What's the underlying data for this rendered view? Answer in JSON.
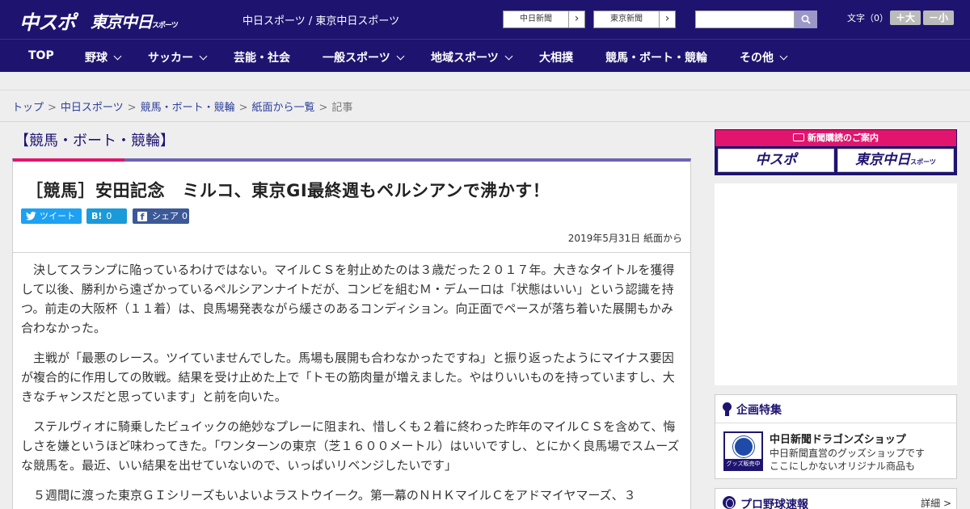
{
  "header": {
    "logo_chuspo": "中スポ",
    "logo_tokyo": "東京中日",
    "logo_tokyo_suffix": "スポーツ",
    "site_links": "中日スポーツ / 東京中日スポーツ",
    "paper_buttons": [
      "中日新聞",
      "東京新聞"
    ],
    "arrow": "›",
    "search": {
      "placeholder": "",
      "icon": "search-icon"
    },
    "font_size": {
      "label": "文字（0）",
      "larger": "＋大",
      "smaller": "－小"
    }
  },
  "nav": {
    "items": [
      {
        "label": "TOP",
        "has_dropdown": false
      },
      {
        "label": "野球",
        "has_dropdown": true
      },
      {
        "label": "サッカー",
        "has_dropdown": true
      },
      {
        "label": "芸能・社会",
        "has_dropdown": false
      },
      {
        "label": "一般スポーツ",
        "has_dropdown": true
      },
      {
        "label": "地域スポーツ",
        "has_dropdown": true
      },
      {
        "label": "大相撲",
        "has_dropdown": false
      },
      {
        "label": "競馬・ボート・競輪",
        "has_dropdown": false
      },
      {
        "label": "その他",
        "has_dropdown": true
      }
    ]
  },
  "breadcrumb": {
    "items": [
      "トップ",
      "中日スポーツ",
      "競馬・ボート・競輪",
      "紙面から一覧",
      "記事"
    ],
    "separator": ">"
  },
  "category_title": "【競馬・ボート・競輪】",
  "article": {
    "headline": "［競馬］安田記念　ミルコ、東京GI最終週もペルシアンで沸かす！",
    "share": {
      "tweet": "ツイート",
      "hatena_icon": "B!",
      "hatena_count": "0",
      "facebook_icon": "f",
      "facebook_label": "シェア",
      "facebook_count": "0"
    },
    "date": "2019年5月31日 紙面から",
    "paragraphs": [
      "決してスランプに陥っているわけではない。マイルＣＳを射止めたのは３歳だった２０１７年。大きなタイトルを獲得して以後、勝利から遠ざかっているペルシアンナイトだが、コンビを組むＭ・デムーロは「状態はいい」という認識を持つ。前走の大阪杯（１１着）は、良馬場発表ながら緩さのあるコンディション。向正面でペースが落ち着いた展開もかみ合わなかった。",
      "主戦が「最悪のレース。ツイていませんでした。馬場も展開も合わなかったですね」と振り返ったようにマイナス要因が複合的に作用しての敗戦。結果を受け止めた上で「トモの筋肉量が増えました。やはりいいものを持っていますし、大きなチャンスだと思っています」と前を向いた。",
      "ステルヴィオに騎乗したビュイックの絶妙なプレーに阻まれ、惜しくも２着に終わった昨年のマイルＣＳを含めて、悔しさを嫌というほど味わってきた。「ワンターンの東京（芝１６００メートル）はいいですし、とにかく良馬場でスムーズな競馬を。最近、いい結果を出せていないので、いっぱいリベンジしたいです」",
      "５週間に渡った東京ＧＩシリーズもいよいよラストウイーク。第一幕のＮＨＫマイルＣをアドマイヤマーズ、３"
    ]
  },
  "sidebar": {
    "subscription": {
      "title": "新聞購読のご案内",
      "logo_left": "中スポ",
      "logo_right": "東京中日",
      "logo_right_suffix": "スポーツ"
    },
    "feature": {
      "title": "企画特集",
      "shop_title": "中日新聞ドラゴンズショップ",
      "shop_desc_1": "中日新聞直営のグッズショップです",
      "shop_desc_2": "ここにしかないオリジナル商品も",
      "shop_badge": "グッズ販売中"
    },
    "baseball": {
      "title": "プロ野球速報",
      "more": "詳細 >"
    }
  },
  "colors": {
    "brand_navy": "#1e1470",
    "accent_pink": "#e2156e",
    "article_border": "#6c64b4",
    "twitter": "#1da1f2",
    "hatena": "#1a9ad9",
    "facebook": "#3b5998"
  }
}
